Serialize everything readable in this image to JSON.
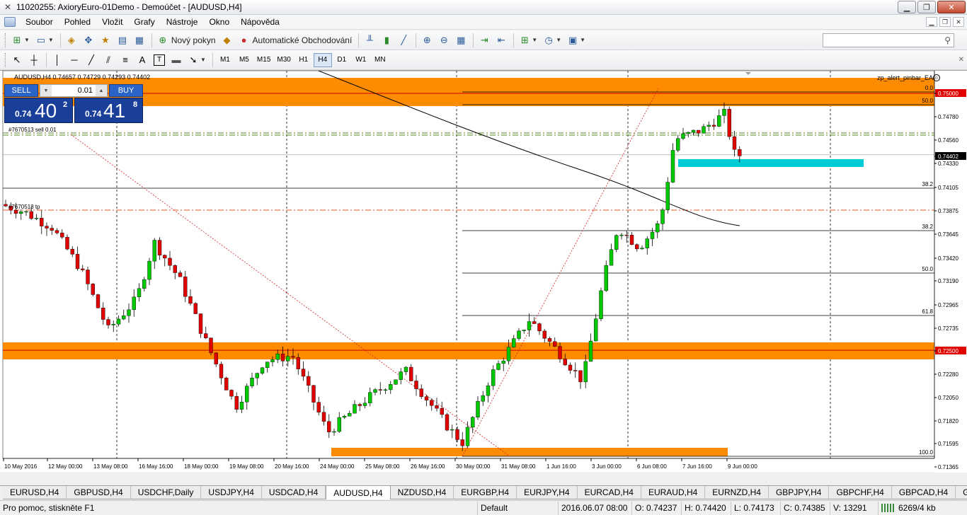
{
  "window": {
    "title": "11020255: AxioryEuro-01Demo - Demoúčet - [AUDUSD,H4]"
  },
  "menu": [
    {
      "label": "Soubor"
    },
    {
      "label": "Pohled"
    },
    {
      "label": "Vložit"
    },
    {
      "label": "Grafy"
    },
    {
      "label": "Nástroje"
    },
    {
      "label": "Okno"
    },
    {
      "label": "Nápověda"
    }
  ],
  "toolbar": {
    "new_order": "Nový pokyn",
    "auto_trading": "Automatické Obchodování"
  },
  "drawing_tools": {
    "text_tool": "A",
    "label_tool": "T"
  },
  "timeframes": [
    {
      "label": "M1"
    },
    {
      "label": "M5"
    },
    {
      "label": "M15"
    },
    {
      "label": "M30"
    },
    {
      "label": "H1"
    },
    {
      "label": "H4",
      "active": true
    },
    {
      "label": "D1"
    },
    {
      "label": "W1"
    },
    {
      "label": "MN"
    }
  ],
  "chart": {
    "header": "AUDUSD,H4  0.74657 0.74729 0.74293 0.74402",
    "ea": "zp_alert_pinbar_EA",
    "order_label_sell": "#7670513 sell 0.01",
    "order_label_tp": "#7670513 tp",
    "fib_levels_top": [
      "0.0",
      "50.0"
    ],
    "fib_levels_mid": [
      "38.2",
      "38.2",
      "50.0",
      "61.8",
      "100.0"
    ],
    "colors": {
      "zone": "#ff8c00",
      "bull": "#00c800",
      "bear": "#e00000",
      "cyan": "#00ccd6",
      "current": "#000000"
    }
  },
  "one_click": {
    "sell_label": "SELL",
    "buy_label": "BUY",
    "lot": "0.01",
    "sell_price_small": "0.74",
    "sell_price_big": "40",
    "sell_price_sup": "2",
    "buy_price_small": "0.74",
    "buy_price_big": "41",
    "buy_price_sup": "8"
  },
  "price_axis": [
    {
      "label": "0.75000",
      "highlight": "red"
    },
    {
      "label": "0.74780"
    },
    {
      "label": "0.74560"
    },
    {
      "label": "0.74402",
      "highlight": "black"
    },
    {
      "label": "0.74330"
    },
    {
      "label": "0.74105"
    },
    {
      "label": "0.73875"
    },
    {
      "label": "0.73645"
    },
    {
      "label": "0.73420"
    },
    {
      "label": "0.73190"
    },
    {
      "label": "0.72965"
    },
    {
      "label": "0.72735"
    },
    {
      "label": "0.72500",
      "highlight": "red"
    },
    {
      "label": "0.72280"
    },
    {
      "label": "0.72050"
    },
    {
      "label": "0.71820"
    },
    {
      "label": "0.71595"
    },
    {
      "label": "0.71365"
    }
  ],
  "time_axis": [
    "10 May 2016",
    "12 May 00:00",
    "13 May 08:00",
    "16 May 16:00",
    "18 May 00:00",
    "19 May 08:00",
    "20 May 16:00",
    "24 May 00:00",
    "25 May 08:00",
    "26 May 16:00",
    "30 May 00:00",
    "31 May 08:00",
    "1 Jun 16:00",
    "3 Jun 00:00",
    "6 Jun 08:00",
    "7 Jun 16:00",
    "9 Jun 00:00"
  ],
  "tabs": [
    {
      "label": "EURUSD,H4"
    },
    {
      "label": "GBPUSD,H4"
    },
    {
      "label": "USDCHF,Daily"
    },
    {
      "label": "USDJPY,H4"
    },
    {
      "label": "USDCAD,H4"
    },
    {
      "label": "AUDUSD,H4",
      "active": true
    },
    {
      "label": "NZDUSD,H4"
    },
    {
      "label": "EURGBP,H4"
    },
    {
      "label": "EURJPY,H4"
    },
    {
      "label": "EURCAD,H4"
    },
    {
      "label": "EURAUD,H4"
    },
    {
      "label": "EURNZD,H4"
    },
    {
      "label": "GBPJPY,H4"
    },
    {
      "label": "GBPCHF,H4"
    },
    {
      "label": "GBPCAD,H4"
    },
    {
      "label": "GBPAU"
    }
  ],
  "status": {
    "help": "Pro pomoc, stiskněte F1",
    "profile": "Default",
    "datetime": "2016.06.07 08:00",
    "open": "O: 0.74237",
    "high": "H: 0.74420",
    "low": "L: 0.74173",
    "close": "C: 0.74385",
    "volume": "V: 13291",
    "traffic": "6269/4 kb"
  }
}
